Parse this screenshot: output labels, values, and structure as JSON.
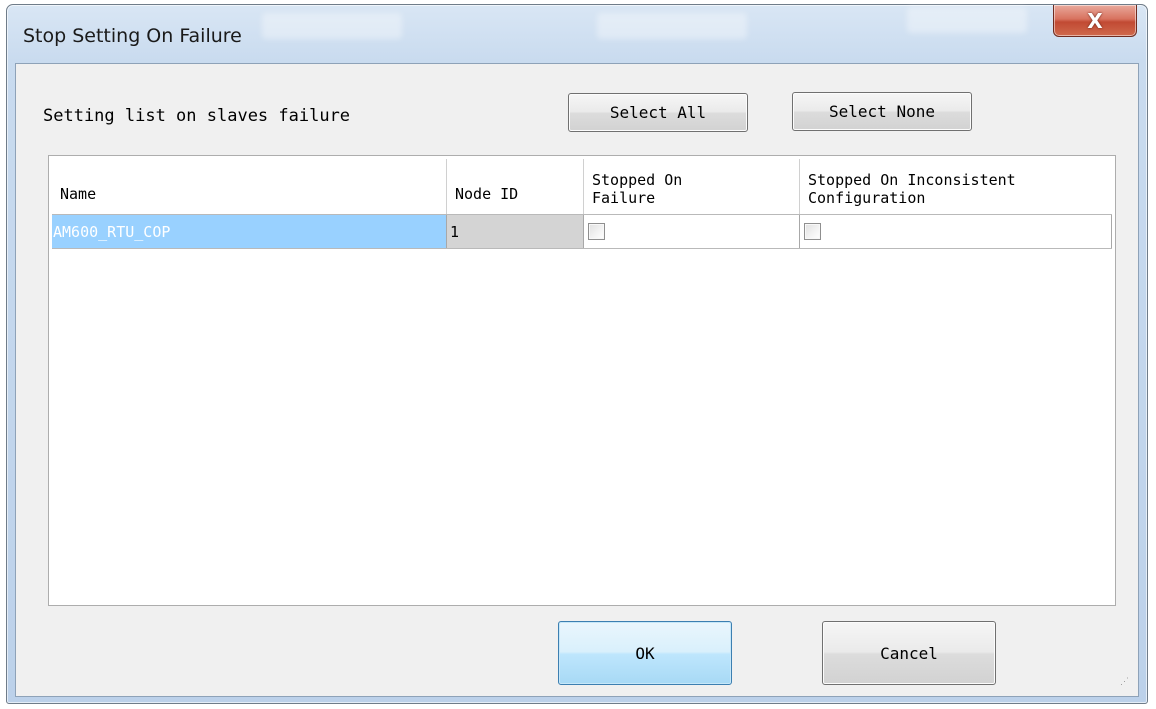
{
  "dialog": {
    "title": "Stop Setting On Failure",
    "close_label": "X"
  },
  "header": {
    "description": "Setting list on slaves failure",
    "select_all_label": "Select All",
    "select_none_label": "Select None"
  },
  "table": {
    "columns": [
      {
        "label_line1": "Name",
        "label_line2": ""
      },
      {
        "label_line1": "Node ID",
        "label_line2": ""
      },
      {
        "label_line1": "Stopped On",
        "label_line2": "Failure"
      },
      {
        "label_line1": "Stopped On Inconsistent",
        "label_line2": "Configuration"
      }
    ],
    "rows": [
      {
        "name": "AM600_RTU_COP",
        "node_id": "1",
        "stopped_on_failure": false,
        "stopped_on_inconsistent": false
      }
    ]
  },
  "footer": {
    "ok_label": "OK",
    "cancel_label": "Cancel"
  },
  "colors": {
    "selection": "#99d1ff",
    "readonly_cell": "#d4d4d4",
    "close_button": "#c14a33"
  }
}
